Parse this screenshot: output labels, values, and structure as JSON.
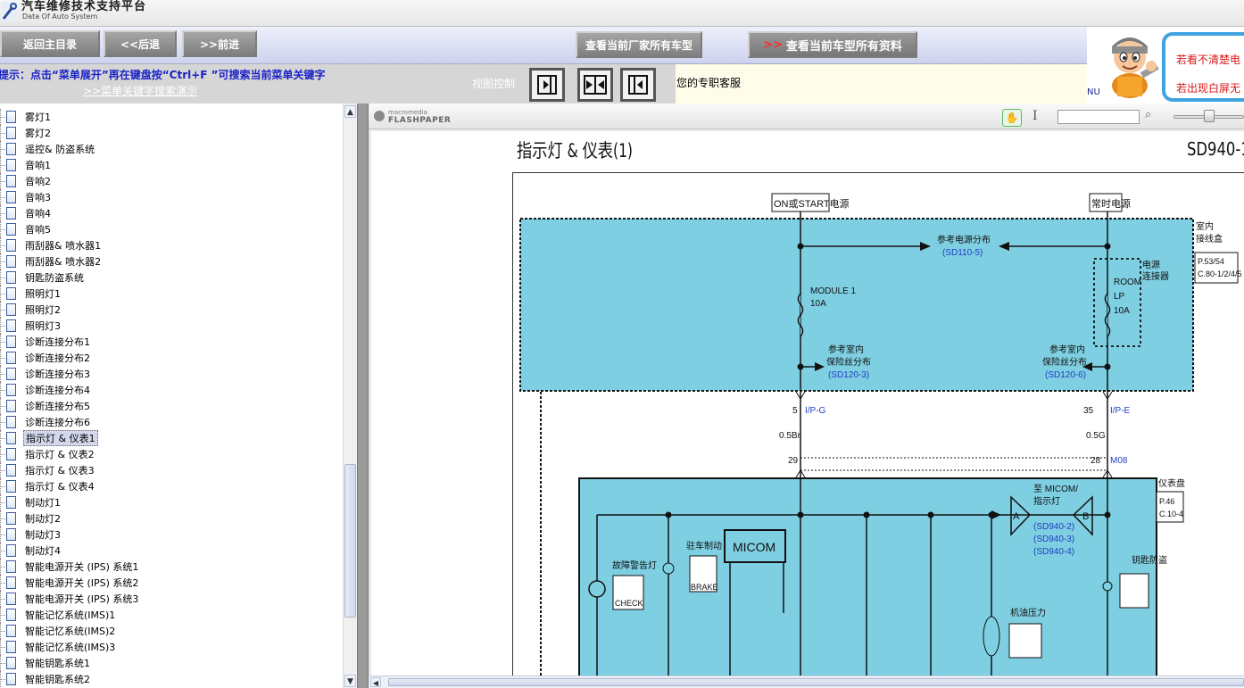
{
  "header": {
    "title": "汽车维修技术支持平台",
    "subtitle": "Data Of Auto System"
  },
  "nav": {
    "home": "返回主目录",
    "back": "<<后退",
    "forward": ">>前进",
    "all_models": "查看当前厂家所有车型",
    "all_info_chevron": ">>",
    "all_info": "查看当前车型所有资料"
  },
  "hint": {
    "text": "提示：点击“菜单展开”再在键盘按“Ctrl+F ”可搜索当前菜单关键字",
    "link": ">>菜单关键字搜索演示",
    "view_control": "视图控制",
    "service": "您的专职客服"
  },
  "notice": {
    "mascot_caption": "NU",
    "line1": "若看不清楚电",
    "line2": "若出现白屏无"
  },
  "menu": {
    "items": [
      "雾灯1",
      "雾灯2",
      "遥控& 防盗系统",
      "音响1",
      "音响2",
      "音响3",
      "音响4",
      "音响5",
      "雨刮器& 喷水器1",
      "雨刮器& 喷水器2",
      "钥匙防盗系统",
      "照明灯1",
      "照明灯2",
      "照明灯3",
      "诊断连接分布1",
      "诊断连接分布2",
      "诊断连接分布3",
      "诊断连接分布4",
      "诊断连接分布5",
      "诊断连接分布6",
      "指示灯 & 仪表1",
      "指示灯 & 仪表2",
      "指示灯 & 仪表3",
      "指示灯 & 仪表4",
      "制动灯1",
      "制动灯2",
      "制动灯3",
      "制动灯4",
      "智能电源开关 (IPS) 系统1",
      "智能电源开关 (IPS) 系统2",
      "智能电源开关 (IPS) 系统3",
      "智能记忆系统(IMS)1",
      "智能记忆系统(IMS)2",
      "智能记忆系统(IMS)3",
      "智能钥匙系统1",
      "智能钥匙系统2"
    ],
    "selected_index": 20
  },
  "viewer": {
    "brand_small": "macromedia",
    "brand": "FLASHPAPER",
    "search_value": "",
    "zoom_fraction": 0.5
  },
  "document": {
    "title": "指示灯 & 仪表(1)",
    "code": "SD940-1",
    "labels": {
      "power_on": "ON或START电源",
      "power_batt": "常时电源",
      "power_dist": "参考电源分布",
      "power_dist_ref": "(SD110-5)",
      "junction": [
        "室内",
        "接线盒"
      ],
      "junction_pages": [
        "P.53/54",
        "C.80-1/2/4/5"
      ],
      "module": [
        "MODULE 1",
        "10A"
      ],
      "room": [
        "ROOM",
        "LP",
        "10A"
      ],
      "power_conn": [
        "电源",
        "连接器"
      ],
      "fuse_ref_left": [
        "参考室内",
        "保险丝分布"
      ],
      "fuse_ref_left_code": "(SD120-3)",
      "fuse_ref_right": [
        "参考室内",
        "保险丝分布"
      ],
      "fuse_ref_right_code": "(SD120-6)",
      "pin_left_top": "5",
      "pin_left_conn": "I/P-G",
      "wire_left": "0.5Br",
      "pin_left_bot": "29",
      "pin_right_top": "35",
      "pin_right_conn": "I/P-E",
      "wire_right": "0.5G",
      "pin_right_bot": "28",
      "pin_right_m": "M08",
      "cluster": "仪表盘",
      "cluster_pages": [
        "P.46",
        "C.10-4"
      ],
      "arrow_a": "A",
      "arrow_b": "B",
      "micom_to": [
        "至 MICOM/",
        "指示灯"
      ],
      "micom_refs": [
        "(SD940-2)",
        "(SD940-3)",
        "(SD940-4)"
      ],
      "fault_lamp": "故障警告灯",
      "check": "CHECK",
      "parking": "驻车制动",
      "brake": "BRAKE",
      "micom": "MICOM",
      "key_warn": "钥匙防盗",
      "oil_pressure": "机油压力"
    }
  }
}
